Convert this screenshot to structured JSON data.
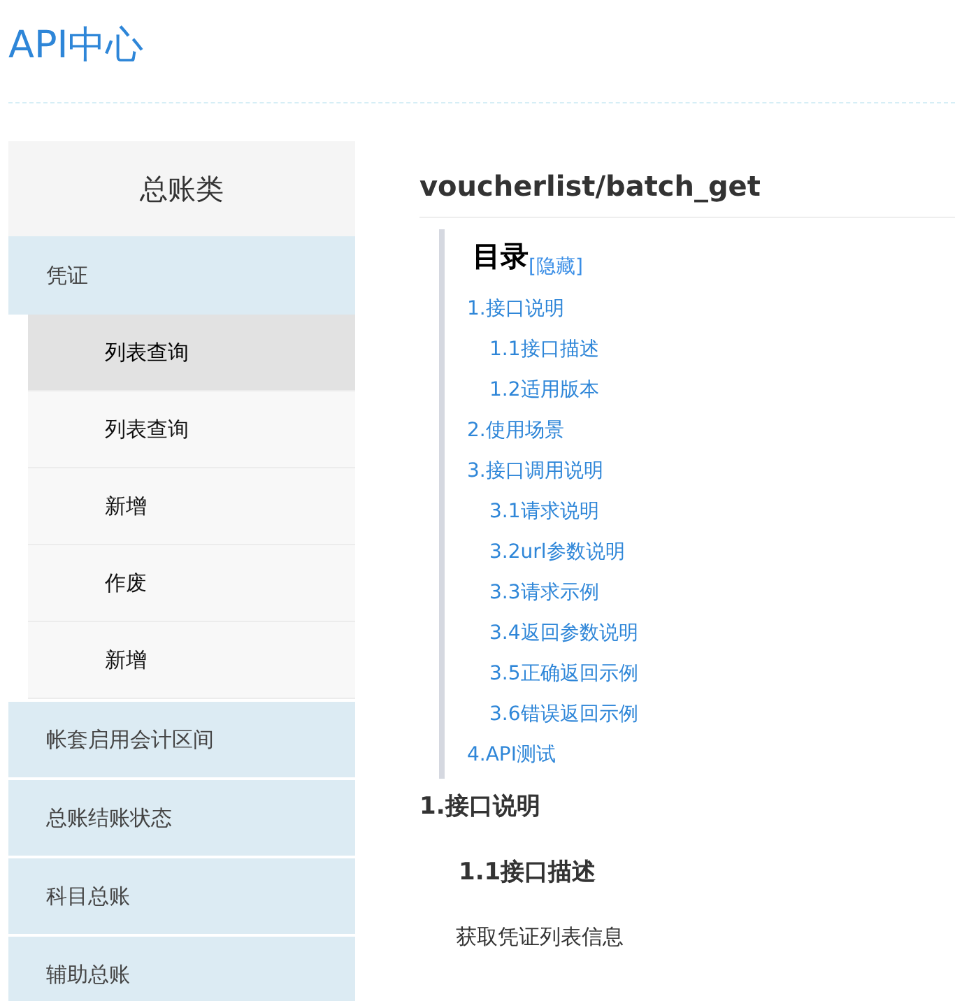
{
  "header": {
    "title": "API中心"
  },
  "sidebar": {
    "heading": "总账类",
    "categories": [
      {
        "label": "凭证",
        "expanded": true,
        "children": [
          {
            "label": "列表查询",
            "selected": true
          },
          {
            "label": "列表查询",
            "selected": false
          },
          {
            "label": "新增",
            "selected": false
          },
          {
            "label": "作废",
            "selected": false
          },
          {
            "label": "新增",
            "selected": false
          }
        ]
      },
      {
        "label": "帐套启用会计区间",
        "expanded": false
      },
      {
        "label": "总账结账状态",
        "expanded": false
      },
      {
        "label": "科目总账",
        "expanded": false
      },
      {
        "label": "辅助总账",
        "expanded": false
      }
    ]
  },
  "content": {
    "title": "voucherlist/batch_get",
    "toc": {
      "heading": "目录",
      "toggle": "[隐藏]",
      "items": [
        {
          "label": "1.接口说明",
          "children": [
            {
              "label": "1.1接口描述"
            },
            {
              "label": "1.2适用版本"
            }
          ]
        },
        {
          "label": "2.使用场景"
        },
        {
          "label": "3.接口调用说明",
          "children": [
            {
              "label": "3.1请求说明"
            },
            {
              "label": "3.2url参数说明"
            },
            {
              "label": "3.3请求示例"
            },
            {
              "label": "3.4返回参数说明"
            },
            {
              "label": "3.5正确返回示例"
            },
            {
              "label": "3.6错误返回示例"
            }
          ]
        },
        {
          "label": "4.API测试"
        }
      ]
    },
    "section_heading": "1.接口说明",
    "subsection_heading": "1.1接口描述",
    "paragraph": "获取凭证列表信息"
  }
}
